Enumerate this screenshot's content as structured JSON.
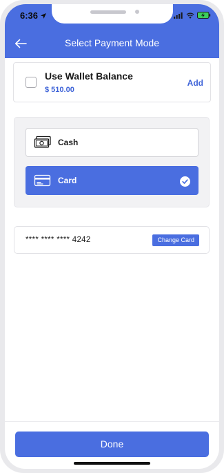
{
  "status_bar": {
    "time": "6:36"
  },
  "header": {
    "title": "Select Payment Mode"
  },
  "wallet": {
    "title": "Use Wallet Balance",
    "amount": "$ 510.00",
    "add_label": "Add",
    "checked": false
  },
  "payment_modes": [
    {
      "label": "Cash",
      "icon": "cash-icon",
      "selected": false
    },
    {
      "label": "Card",
      "icon": "card-icon",
      "selected": true
    }
  ],
  "saved_card": {
    "number": "**** **** **** 4242",
    "change_label": "Change Card"
  },
  "footer": {
    "done_label": "Done"
  },
  "colors": {
    "accent": "#4a6ee0",
    "accent_text": "#3e63d8"
  }
}
